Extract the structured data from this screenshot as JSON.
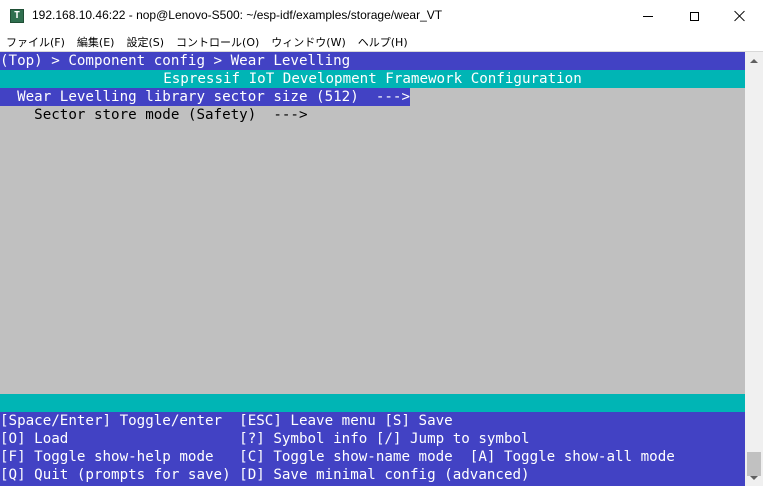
{
  "window": {
    "title": "192.168.10.46:22 - nop@Lenovo-S500: ~/esp-idf/examples/storage/wear_VT",
    "icon_label": "T"
  },
  "menu": {
    "items": [
      {
        "label": "ファイル(F)"
      },
      {
        "label": "編集(E)"
      },
      {
        "label": "設定(S)"
      },
      {
        "label": "コントロール(O)"
      },
      {
        "label": "ウィンドウ(W)"
      },
      {
        "label": "ヘルプ(H)"
      }
    ]
  },
  "terminal": {
    "breadcrumb": "(Top) > Component config > Wear Levelling",
    "header": "Espressif IoT Development Framework Configuration",
    "items": [
      {
        "label": "  Wear Levelling library sector size (512)  --->",
        "selected": true
      },
      {
        "label": "    Sector store mode (Safety)  --->",
        "selected": false
      }
    ],
    "help_lines": [
      "[Space/Enter] Toggle/enter  [ESC] Leave menu [S] Save",
      "[O] Load                    [?] Symbol info [/] Jump to symbol",
      "[F] Toggle show-help mode   [C] Toggle show-name mode  [A] Toggle show-all mode",
      "[Q] Quit (prompts for save) [D] Save minimal config (advanced)"
    ]
  },
  "colors": {
    "terminal_bg": "#c0c0c0",
    "blue": "#4242c4",
    "cyan": "#00b5b5",
    "text_white": "#ffffff",
    "text_black": "#000000"
  }
}
